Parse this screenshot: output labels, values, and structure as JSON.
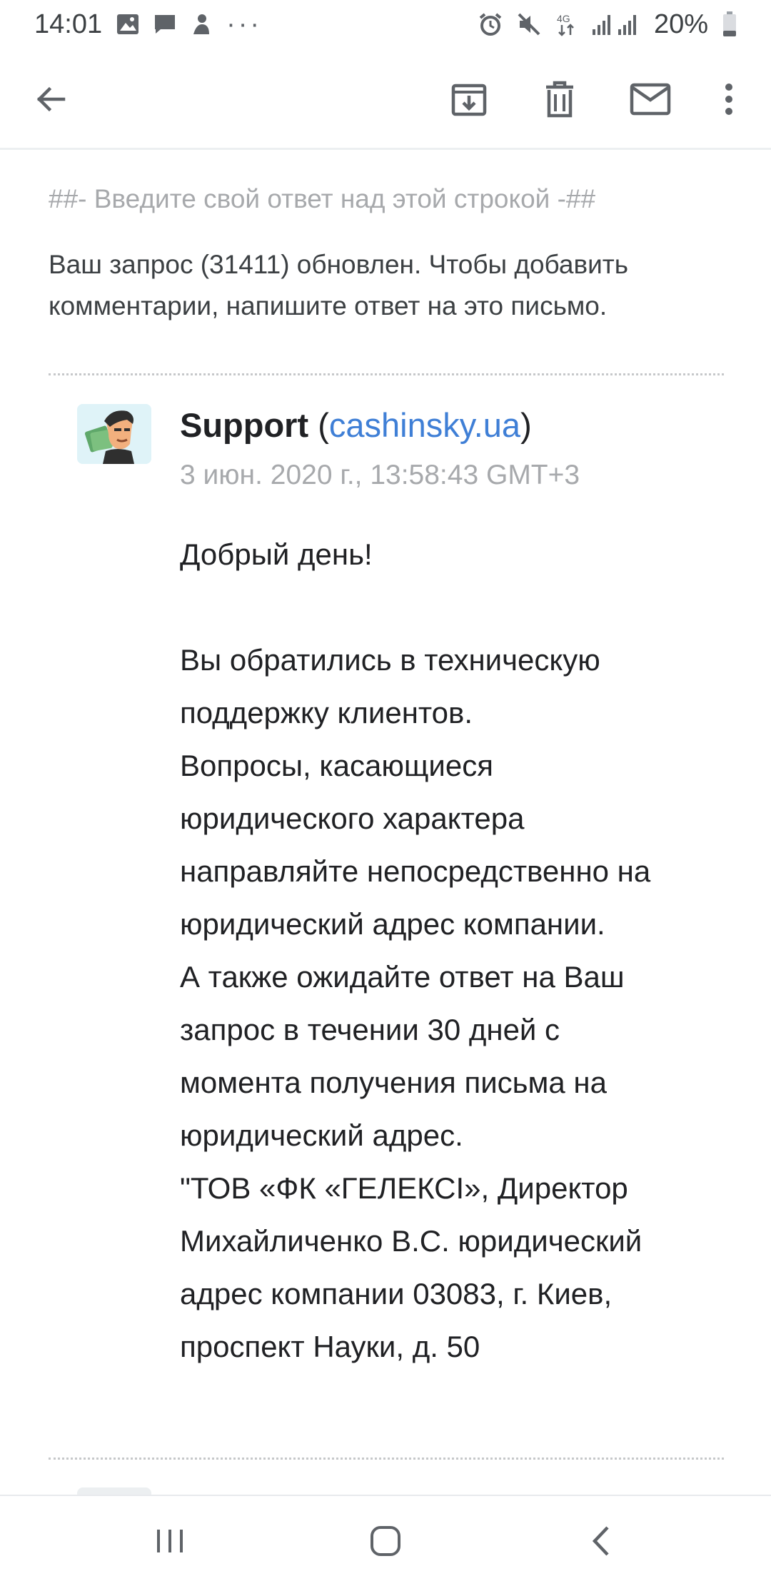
{
  "status_bar": {
    "time": "14:01",
    "more": "···",
    "network": "4G",
    "battery": "20%",
    "left_icons": [
      "image-icon",
      "chat-icon",
      "app-notification-icon"
    ],
    "right_icons": [
      "alarm-icon",
      "mute-icon",
      "network-4g-icon",
      "signal-icon",
      "battery-icon"
    ]
  },
  "toolbar": {
    "back": "back-arrow-icon",
    "archive": "archive-icon",
    "delete": "trash-icon",
    "mark_unread": "mail-icon",
    "more": "more-vert-icon"
  },
  "email": {
    "reply_line": "##- Введите свой ответ над этой строкой -##",
    "notice_lines": [
      "Ваш запрос (31411) обновлен. Чтобы добавить",
      "комментарии, напишите ответ на это письмо."
    ],
    "sender_name": "Support",
    "sender_open": " (",
    "sender_domain": "cashinsky.ua",
    "sender_close": ")",
    "date": "3 июн. 2020 г., 13:58:43 GMT+3",
    "greeting": "Добрый день!",
    "body_lines": [
      "Вы обратились в техническую",
      "поддержку клиентов.",
      "Вопросы, касающиеся",
      "юридического характера",
      "направляйте непосредственно на",
      "юридический адрес компании.",
      "А также ожидайте ответ на Ваш",
      "запрос в течении 30 дней с",
      "момента получения письма на",
      "юридический адрес.",
      "\"ТОВ «ФК «ГЕЛЕКСІ», Директор",
      "Михайличенко В.С. юридический",
      "адрес компании 03083, г. Киев,",
      "проспект Науки, д. 50"
    ]
  },
  "nav_bar": {
    "recents": "recents-icon",
    "home": "home-icon",
    "back": "nav-back-icon"
  },
  "colors": {
    "link": "#3f7fd6",
    "muted": "#a7a9ac",
    "text": "#202124",
    "avatar_bg": "#dff3f8"
  }
}
